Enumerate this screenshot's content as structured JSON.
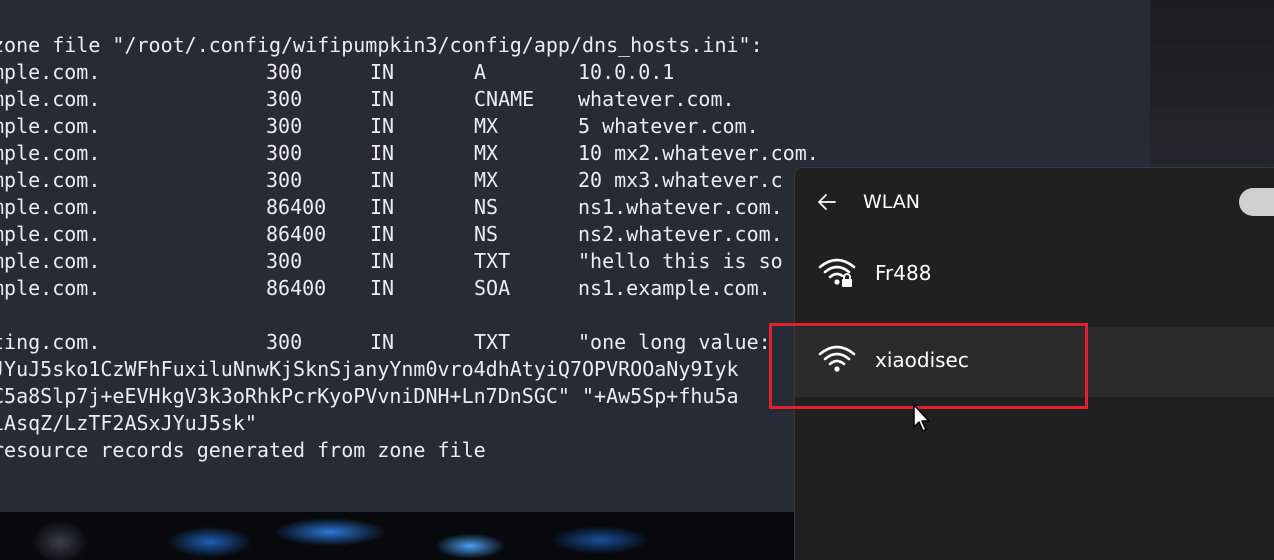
{
  "terminal": {
    "lines": [
      {
        "text": "zone file \"/root/.config/wifipumpkin3/config/app/dns_hosts.ini\":"
      },
      {
        "name": "mple.com.",
        "ttl": "300",
        "class": "IN",
        "type": "A",
        "value": "10.0.0.1"
      },
      {
        "name": "mple.com.",
        "ttl": "300",
        "class": "IN",
        "type": "CNAME",
        "value": "whatever.com."
      },
      {
        "name": "mple.com.",
        "ttl": "300",
        "class": "IN",
        "type": "MX",
        "value": "5 whatever.com."
      },
      {
        "name": "mple.com.",
        "ttl": "300",
        "class": "IN",
        "type": "MX",
        "value": "10 mx2.whatever.com."
      },
      {
        "name": "mple.com.",
        "ttl": "300",
        "class": "IN",
        "type": "MX",
        "value": "20 mx3.whatever.c"
      },
      {
        "name": "mple.com.",
        "ttl": "86400",
        "class": "IN",
        "type": "NS",
        "value": "ns1.whatever.com."
      },
      {
        "name": "mple.com.",
        "ttl": "86400",
        "class": "IN",
        "type": "NS",
        "value": "ns2.whatever.com."
      },
      {
        "name": "mple.com.",
        "ttl": "300",
        "class": "IN",
        "type": "TXT",
        "value": "\"hello this is so"
      },
      {
        "name": "mple.com.",
        "ttl": "86400",
        "class": "IN",
        "type": "SOA",
        "value": "ns1.example.com."
      },
      {
        "text": ""
      },
      {
        "name": "ting.com.",
        "ttl": "300",
        "class": "IN",
        "type": "TXT",
        "value": "\"one long value:"
      },
      {
        "text": "JYuJ5sko1CzWFhFuxiluNnwKjSknSjanyYnm0vro4dhAtyiQ7OPVROOaNy9Iyk"
      },
      {
        "text": "C5a8Slp7j+eEVHkgV3k3oRhkPcrKyoPVvniDNH+Ln7DnSGC\" \"+Aw5Sp+fhu5a"
      },
      {
        "text": "iAsqZ/LzTF2ASxJYuJ5sk\""
      },
      {
        "text": "resource records generated from zone file"
      }
    ]
  },
  "wlan": {
    "title": "WLAN",
    "networks": [
      {
        "name": "Fr488",
        "secured": true
      },
      {
        "name": "xiaodisec",
        "secured": false
      }
    ]
  },
  "colors": {
    "terminal_bg": "#262b36",
    "flyout_bg": "#202020",
    "highlight": "#e0202c"
  },
  "icons": [
    "back-arrow-icon",
    "wifi-lock-icon",
    "wifi-icon",
    "mouse-cursor-icon"
  ]
}
